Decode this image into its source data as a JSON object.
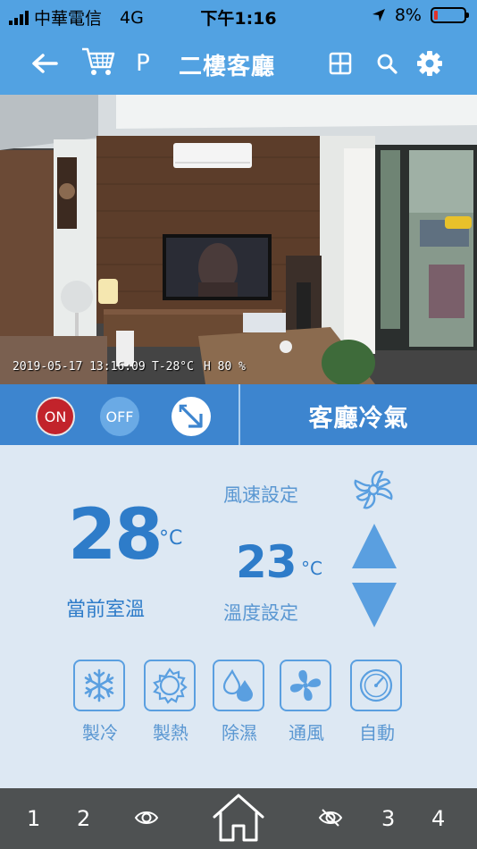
{
  "status_bar": {
    "carrier": "中華電信",
    "network": "4G",
    "time": "下午1:16",
    "battery": "8%",
    "battery_level": 0.08
  },
  "nav": {
    "title": "二樓客廳",
    "p_label": "P",
    "icons": [
      "back-arrow-icon",
      "cart-icon",
      "grid-icon",
      "search-icon",
      "gear-icon"
    ]
  },
  "camera": {
    "timestamp": "2019-05-17 13:16:09",
    "temp_readout": "T-28°C",
    "humidity_readout": "H 80 %"
  },
  "controls": {
    "on_label": "ON",
    "off_label": "OFF",
    "device_name": "客廳冷氣",
    "colors": {
      "on": "#c2232b",
      "off": "#6aaae5",
      "bar": "#3d85cf"
    }
  },
  "panel": {
    "current_temp": "28",
    "current_unit": "°C",
    "current_label": "當前室溫",
    "fan_label": "風速設定",
    "set_temp": "23",
    "set_unit": "°C",
    "set_label": "溫度設定",
    "modes": [
      {
        "label": "製冷",
        "icon": "snowflake-icon"
      },
      {
        "label": "製熱",
        "icon": "sun-icon"
      },
      {
        "label": "除濕",
        "icon": "droplet-icon"
      },
      {
        "label": "通風",
        "icon": "fan-icon"
      },
      {
        "label": "自動",
        "icon": "compass-icon"
      }
    ]
  },
  "bottom_bar": {
    "tab1": "1",
    "tab2": "2",
    "tab3": "3",
    "tab4": "4",
    "icons": [
      "eye-icon",
      "home-icon",
      "eye-off-icon"
    ]
  }
}
